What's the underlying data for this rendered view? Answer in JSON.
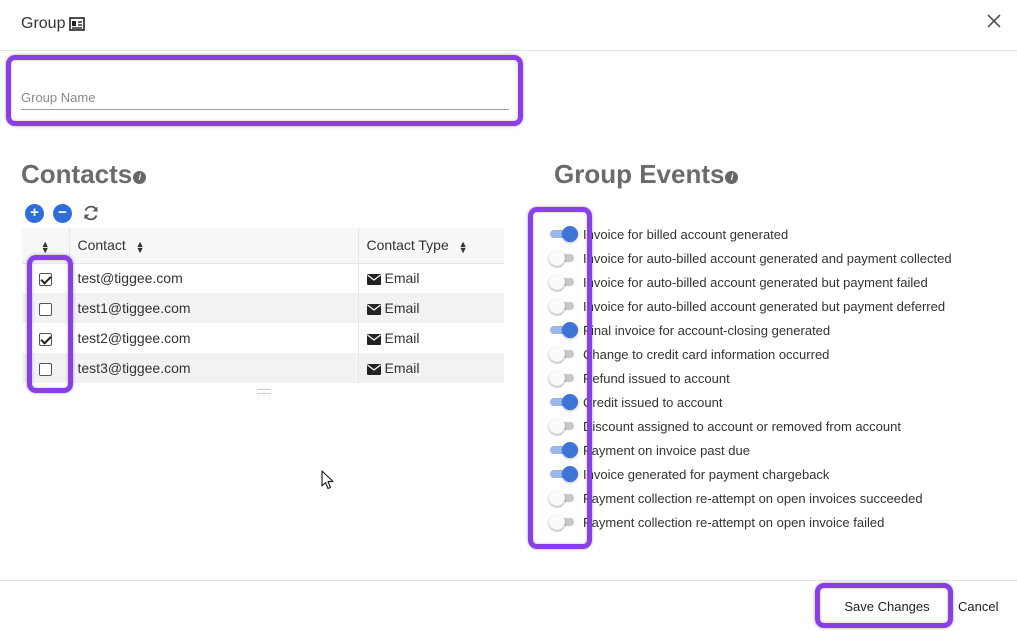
{
  "dialog": {
    "title": "Group",
    "title_icon": "id-card-icon"
  },
  "group_name": {
    "value": "",
    "placeholder": "Group Name"
  },
  "contacts": {
    "heading": "Contacts",
    "toolbar": {
      "add": "+",
      "remove": "−"
    },
    "columns": [
      "Contact",
      "Contact Type"
    ],
    "rows": [
      {
        "email": "test@tiggee.com",
        "type": "Email",
        "checked": true
      },
      {
        "email": "test1@tiggee.com",
        "type": "Email",
        "checked": false
      },
      {
        "email": "test2@tiggee.com",
        "type": "Email",
        "checked": true
      },
      {
        "email": "test3@tiggee.com",
        "type": "Email",
        "checked": false
      }
    ]
  },
  "group_events": {
    "heading": "Group Events",
    "events": [
      {
        "label": "Invoice for billed account generated",
        "enabled": true
      },
      {
        "label": "Invoice for auto-billed account generated and payment collected",
        "enabled": false
      },
      {
        "label": "Invoice for auto-billed account generated but payment failed",
        "enabled": false
      },
      {
        "label": "Invoice for auto-billed account generated but payment deferred",
        "enabled": false
      },
      {
        "label": "Final invoice for account-closing generated",
        "enabled": true
      },
      {
        "label": "Change to credit card information occurred",
        "enabled": false
      },
      {
        "label": "Refund issued to account",
        "enabled": false
      },
      {
        "label": "Credit issued to account",
        "enabled": true
      },
      {
        "label": "Discount assigned to account or removed from account",
        "enabled": false
      },
      {
        "label": "Payment on invoice past due",
        "enabled": true
      },
      {
        "label": "Invoice generated for payment chargeback",
        "enabled": true
      },
      {
        "label": "Payment collection re-attempt on open invoices succeeded",
        "enabled": false
      },
      {
        "label": "Payment collection re-attempt on open invoice failed",
        "enabled": false
      }
    ]
  },
  "footer": {
    "save_label": "Save Changes",
    "cancel_label": "Cancel"
  },
  "colors": {
    "highlight": "#8a3fe6",
    "accent": "#3e74d6",
    "toggle_track_on": "#9bb8ec"
  }
}
